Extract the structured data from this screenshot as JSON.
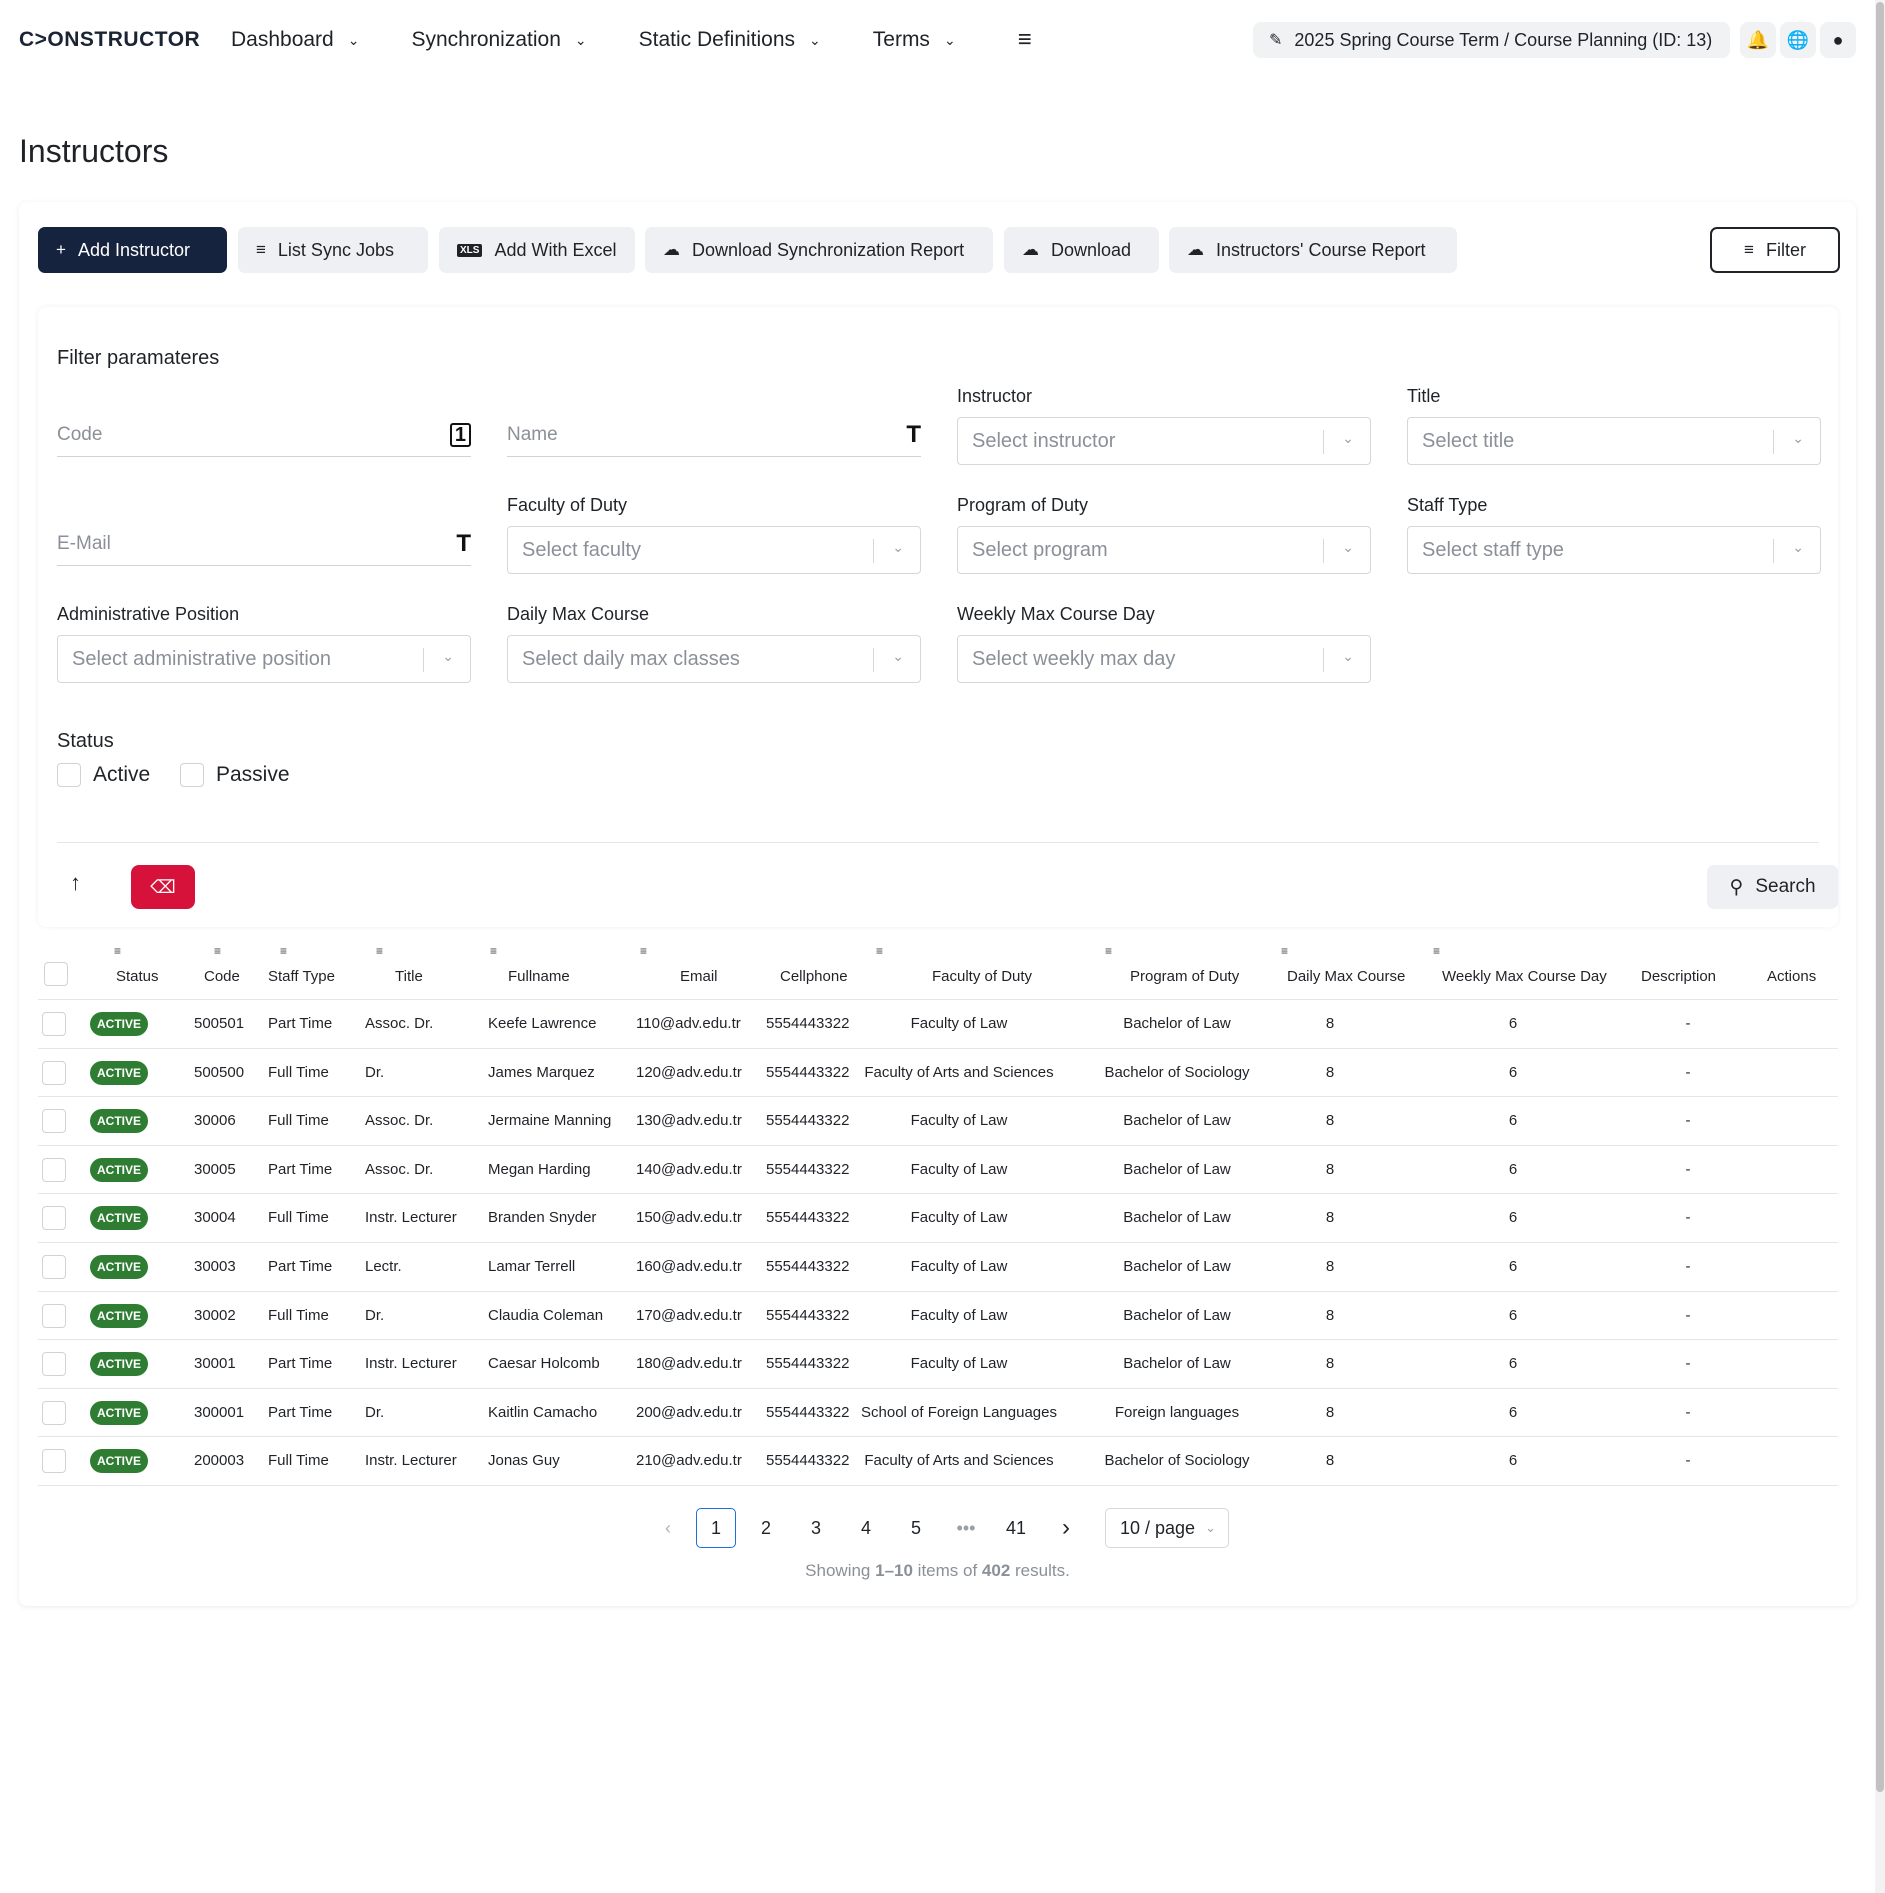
{
  "nav": {
    "logo": "C>ONSTRUCTOR",
    "items": [
      "Dashboard",
      "Synchronization",
      "Static Definitions",
      "Terms"
    ],
    "term": "2025 Spring Course Term / Course Planning (ID: 13)"
  },
  "page": {
    "title": "Instructors"
  },
  "toolbar": {
    "add": "Add Instructor",
    "sync_jobs": "List Sync Jobs",
    "excel": "Add With Excel",
    "sync_report": "Download Synchronization Report",
    "download": "Download",
    "course_report": "Instructors' Course Report",
    "filter": "Filter"
  },
  "filter": {
    "title": "Filter paramateres",
    "code_placeholder": "Code",
    "name_placeholder": "Name",
    "email_placeholder": "E-Mail",
    "instructor_label": "Instructor",
    "instructor_placeholder": "Select instructor",
    "title_label": "Title",
    "title_placeholder": "Select title",
    "faculty_label": "Faculty of Duty",
    "faculty_placeholder": "Select faculty",
    "program_label": "Program of Duty",
    "program_placeholder": "Select program",
    "staff_label": "Staff Type",
    "staff_placeholder": "Select staff type",
    "admin_label": "Administrative Position",
    "admin_placeholder": "Select administrative position",
    "daily_label": "Daily Max Course",
    "daily_placeholder": "Select daily max classes",
    "weekly_label": "Weekly Max Course Day",
    "weekly_placeholder": "Select weekly max day",
    "status_label": "Status",
    "status_active": "Active",
    "status_passive": "Passive",
    "search": "Search"
  },
  "table": {
    "headers": [
      "Status",
      "Code",
      "Staff Type",
      "Title",
      "Fullname",
      "Email",
      "Cellphone",
      "Faculty of Duty",
      "Program of Duty",
      "Daily Max Course",
      "Weekly Max Course Day",
      "Description",
      "Actions"
    ],
    "rows": [
      {
        "status": "ACTIVE",
        "code": "500501",
        "staff": "Part Time",
        "title": "Assoc. Dr.",
        "name": "Keefe Lawrence",
        "email": "110@adv.edu.tr",
        "phone": "5554443322",
        "faculty": "Faculty of Law",
        "program": "Bachelor of Law",
        "daily": "8",
        "weekly": "6",
        "desc": "-"
      },
      {
        "status": "ACTIVE",
        "code": "500500",
        "staff": "Full Time",
        "title": "Dr.",
        "name": "James Marquez",
        "email": "120@adv.edu.tr",
        "phone": "5554443322",
        "faculty": "Faculty of Arts and Sciences",
        "program": "Bachelor of Sociology",
        "daily": "8",
        "weekly": "6",
        "desc": "-"
      },
      {
        "status": "ACTIVE",
        "code": "30006",
        "staff": "Full Time",
        "title": "Assoc. Dr.",
        "name": "Jermaine Manning",
        "email": "130@adv.edu.tr",
        "phone": "5554443322",
        "faculty": "Faculty of Law",
        "program": "Bachelor of Law",
        "daily": "8",
        "weekly": "6",
        "desc": "-"
      },
      {
        "status": "ACTIVE",
        "code": "30005",
        "staff": "Part Time",
        "title": "Assoc. Dr.",
        "name": "Megan Harding",
        "email": "140@adv.edu.tr",
        "phone": "5554443322",
        "faculty": "Faculty of Law",
        "program": "Bachelor of Law",
        "daily": "8",
        "weekly": "6",
        "desc": "-"
      },
      {
        "status": "ACTIVE",
        "code": "30004",
        "staff": "Full Time",
        "title": "Instr. Lecturer",
        "name": "Branden Snyder",
        "email": "150@adv.edu.tr",
        "phone": "5554443322",
        "faculty": "Faculty of Law",
        "program": "Bachelor of Law",
        "daily": "8",
        "weekly": "6",
        "desc": "-"
      },
      {
        "status": "ACTIVE",
        "code": "30003",
        "staff": "Part Time",
        "title": "Lectr.",
        "name": "Lamar Terrell",
        "email": "160@adv.edu.tr",
        "phone": "5554443322",
        "faculty": "Faculty of Law",
        "program": "Bachelor of Law",
        "daily": "8",
        "weekly": "6",
        "desc": "-"
      },
      {
        "status": "ACTIVE",
        "code": "30002",
        "staff": "Full Time",
        "title": "Dr.",
        "name": "Claudia Coleman",
        "email": "170@adv.edu.tr",
        "phone": "5554443322",
        "faculty": "Faculty of Law",
        "program": "Bachelor of Law",
        "daily": "8",
        "weekly": "6",
        "desc": "-"
      },
      {
        "status": "ACTIVE",
        "code": "30001",
        "staff": "Part Time",
        "title": "Instr. Lecturer",
        "name": "Caesar Holcomb",
        "email": "180@adv.edu.tr",
        "phone": "5554443322",
        "faculty": "Faculty of Law",
        "program": "Bachelor of Law",
        "daily": "8",
        "weekly": "6",
        "desc": "-"
      },
      {
        "status": "ACTIVE",
        "code": "300001",
        "staff": "Part Time",
        "title": "Dr.",
        "name": "Kaitlin Camacho",
        "email": "200@adv.edu.tr",
        "phone": "5554443322",
        "faculty": "School of Foreign Languages",
        "program": "Foreign languages",
        "daily": "8",
        "weekly": "6",
        "desc": "-"
      },
      {
        "status": "ACTIVE",
        "code": "200003",
        "staff": "Full Time",
        "title": "Instr. Lecturer",
        "name": "Jonas Guy",
        "email": "210@adv.edu.tr",
        "phone": "5554443322",
        "faculty": "Faculty of Arts and Sciences",
        "program": "Bachelor of Sociology",
        "daily": "8",
        "weekly": "6",
        "desc": "-"
      }
    ]
  },
  "pagination": {
    "pages": [
      "1",
      "2",
      "3",
      "4",
      "5",
      "•••",
      "41"
    ],
    "current": "1",
    "per_page": "10 / page",
    "showing_prefix": "Showing ",
    "range": "1–10",
    "mid": " items of ",
    "total": "402",
    "suffix": " results."
  },
  "colors": {
    "primary": "#15233f",
    "danger": "#d6123a",
    "active_badge": "#2e7d32",
    "page_active": "#1e6fd9"
  }
}
